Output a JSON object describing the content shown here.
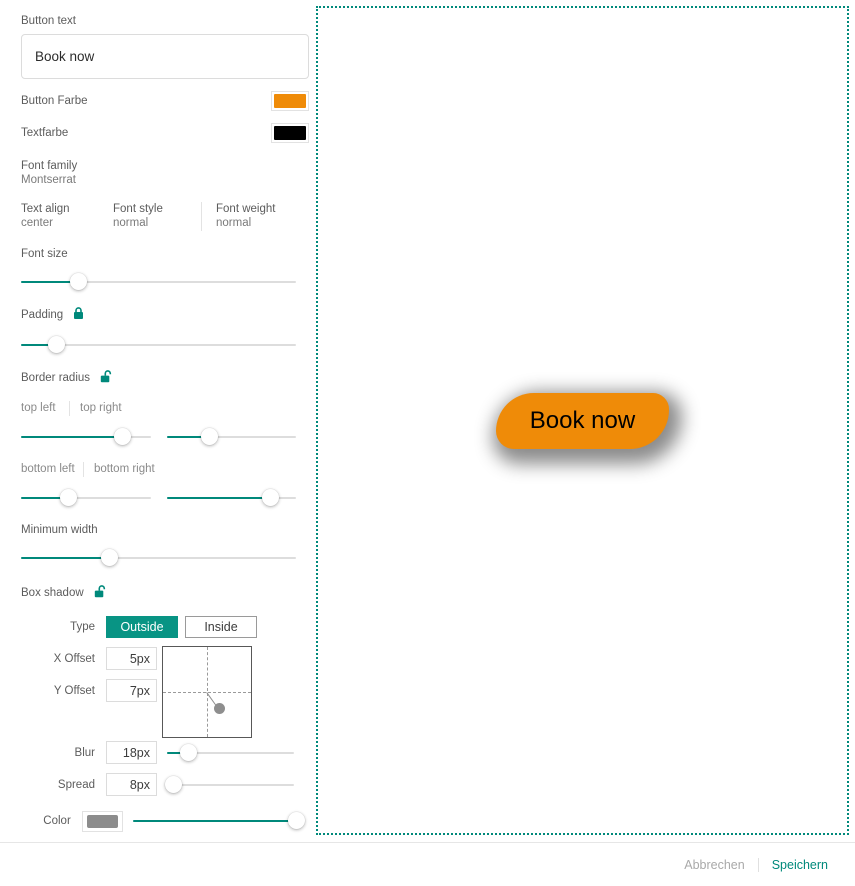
{
  "editor": {
    "button_text": {
      "label": "Button text",
      "value": "Book now"
    },
    "button_color": {
      "label": "Button Farbe",
      "value": "#ef8b08"
    },
    "text_color": {
      "label": "Textfarbe",
      "value": "#000000"
    },
    "font_family": {
      "label": "Font family",
      "value": "Montserrat"
    },
    "text_align": {
      "label": "Text align",
      "value": "center"
    },
    "font_style": {
      "label": "Font style",
      "value": "normal"
    },
    "font_weight": {
      "label": "Font weight",
      "value": "normal"
    },
    "font_size": {
      "label": "Font size",
      "percent": 21
    },
    "padding": {
      "label": "Padding",
      "lock": "locked",
      "percent": 13
    },
    "border_radius": {
      "label": "Border radius",
      "lock": "unlocked",
      "top_left_label": "top left",
      "top_right_label": "top right",
      "bottom_left_label": "bottom left",
      "bottom_right_label": "bottom right",
      "top_left_percent": 78,
      "top_right_percent": 33,
      "bottom_left_percent": 37,
      "bottom_right_percent": 80
    },
    "minimum_width": {
      "label": "Minimum width",
      "percent": 32
    },
    "box_shadow": {
      "label": "Box shadow",
      "lock": "unlocked",
      "type_label": "Type",
      "type_outside": "Outside",
      "type_inside": "Inside",
      "type_selected": "Outside",
      "x_offset_label": "X Offset",
      "x_offset_value": "5px",
      "y_offset_label": "Y Offset",
      "y_offset_value": "7px",
      "blur_label": "Blur",
      "blur_value": "18px",
      "blur_percent": 17,
      "spread_label": "Spread",
      "spread_value": "8px",
      "spread_percent": 5,
      "color_label": "Color",
      "color_value": "#8c8c8c",
      "color_percent": 100
    }
  },
  "preview": {
    "button_label": "Book now"
  },
  "footer": {
    "cancel_label": "Abbrechen",
    "save_label": "Speichern"
  },
  "theme": {
    "accent": "#00897b",
    "accent_solid": "#089484",
    "rail": "#dddddd"
  }
}
